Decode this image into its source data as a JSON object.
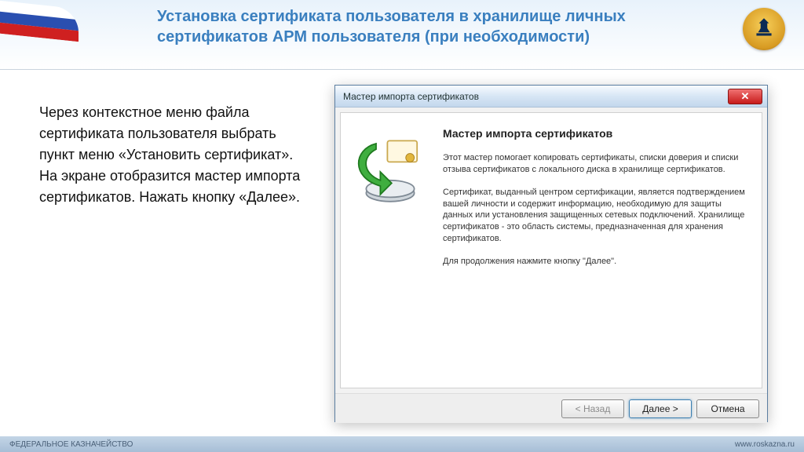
{
  "slide": {
    "title": "Установка сертификата пользователя в хранилище личных сертификатов АРМ пользователя (при необходимости)",
    "body": "Через контекстное меню файла сертификата пользователя выбрать пункт меню «Установить сертификат». На экране отобразится мастер импорта сертификатов. Нажать кнопку «Далее»."
  },
  "dialog": {
    "window_title": "Мастер импорта сертификатов",
    "heading": "Мастер импорта сертификатов",
    "para1": "Этот мастер помогает копировать сертификаты, списки доверия и списки отзыва сертификатов с локального диска в хранилище сертификатов.",
    "para2": "Сертификат, выданный центром сертификации, является подтверждением вашей личности и содержит информацию, необходимую для защиты данных или установления защищенных сетевых подключений. Хранилище сертификатов - это область системы, предназначенная для хранения сертификатов.",
    "para3": "Для продолжения нажмите кнопку \"Далее\".",
    "buttons": {
      "back": "< Назад",
      "next": "Далее >",
      "cancel": "Отмена"
    },
    "close_glyph": "✕"
  },
  "footer": {
    "left": "ФЕДЕРАЛЬНОЕ КАЗНАЧЕЙСТВО",
    "right": "www.roskazna.ru"
  }
}
